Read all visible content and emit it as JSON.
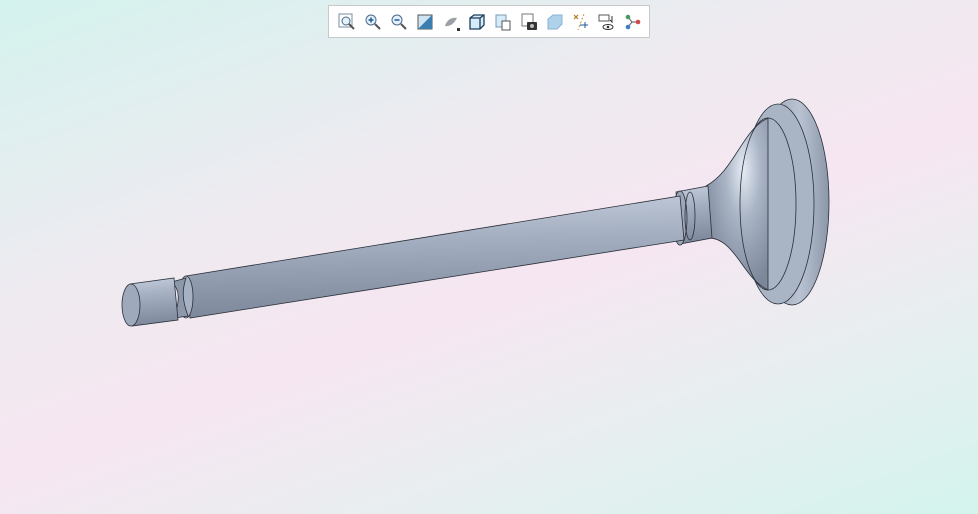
{
  "toolbar": {
    "buttons": [
      {
        "icon": "zoom-fit-icon",
        "tooltip": ""
      },
      {
        "icon": "zoom-in-icon"
      },
      {
        "icon": "zoom-out-icon"
      },
      {
        "icon": "section-view-icon"
      },
      {
        "icon": "display-style-icon"
      },
      {
        "icon": "saved-views-icon"
      },
      {
        "icon": "view-manager-icon"
      },
      {
        "icon": "snapshot-icon"
      },
      {
        "icon": "transparency-icon"
      },
      {
        "icon": "datum-display-icon"
      },
      {
        "icon": "annotation-display-icon"
      },
      {
        "icon": "structure-tree-icon"
      }
    ]
  },
  "model": {
    "part": "valve",
    "color": "#9ea9bb"
  }
}
